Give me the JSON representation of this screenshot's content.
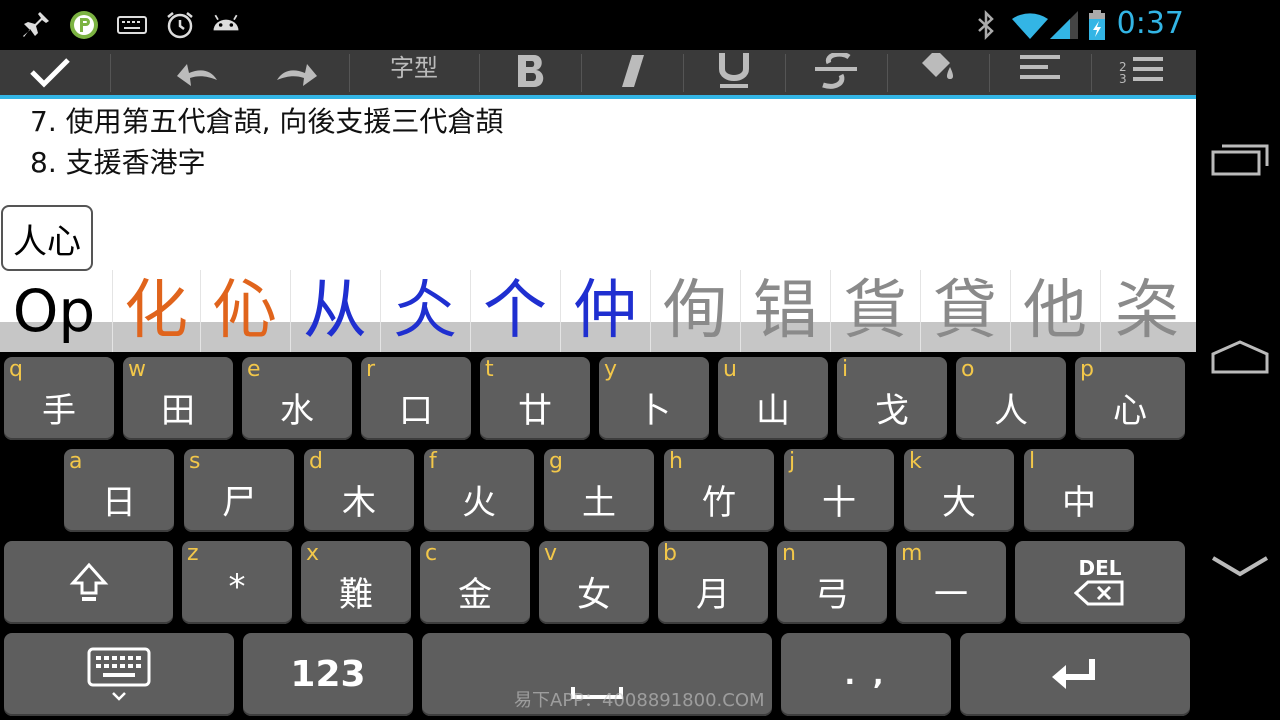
{
  "status_bar": {
    "time": "0:37",
    "left_icons": [
      "pin-icon",
      "app-p-icon",
      "keyboard-notification-icon",
      "alarm-icon",
      "android-icon"
    ],
    "right_icons": [
      "bluetooth-icon",
      "wifi-icon",
      "signal-icon",
      "battery-charging-icon"
    ],
    "accent_color": "#33b5e5"
  },
  "toolbar": {
    "font_label": "字型",
    "buttons": [
      "check-icon",
      "undo-icon",
      "redo-icon",
      "font-icon",
      "bold-icon",
      "italic-icon",
      "underline-icon",
      "strikethrough-icon",
      "fill-color-icon",
      "align-icon",
      "numbered-list-icon"
    ]
  },
  "document": {
    "lines": [
      "7. 使用第五代倉頡, 向後支援三代倉頡",
      "8. 支援香港字"
    ],
    "composing": "人心"
  },
  "candidates": {
    "items": [
      {
        "text": "Op",
        "color": "#000000"
      },
      {
        "text": "化",
        "color": "#e0641c"
      },
      {
        "text": "伈",
        "color": "#e0641c"
      },
      {
        "text": "从",
        "color": "#1f2fd0"
      },
      {
        "text": "仌",
        "color": "#1f2fd0"
      },
      {
        "text": "个",
        "color": "#1f2fd0"
      },
      {
        "text": "仲",
        "color": "#1f2fd0"
      },
      {
        "text": "侚",
        "color": "#8a8a8a"
      },
      {
        "text": "锠",
        "color": "#8a8a8a"
      },
      {
        "text": "貨",
        "color": "#8a8a8a"
      },
      {
        "text": "貸",
        "color": "#8a8a8a"
      },
      {
        "text": "他",
        "color": "#8a8a8a"
      },
      {
        "text": "栥",
        "color": "#8a8a8a"
      }
    ]
  },
  "keyboard": {
    "row1": [
      {
        "hint": "q",
        "label": "手"
      },
      {
        "hint": "w",
        "label": "田"
      },
      {
        "hint": "e",
        "label": "水"
      },
      {
        "hint": "r",
        "label": "口"
      },
      {
        "hint": "t",
        "label": "廿"
      },
      {
        "hint": "y",
        "label": "卜"
      },
      {
        "hint": "u",
        "label": "山"
      },
      {
        "hint": "i",
        "label": "戈"
      },
      {
        "hint": "o",
        "label": "人"
      },
      {
        "hint": "p",
        "label": "心"
      }
    ],
    "row2": [
      {
        "hint": "a",
        "label": "日"
      },
      {
        "hint": "s",
        "label": "尸"
      },
      {
        "hint": "d",
        "label": "木"
      },
      {
        "hint": "f",
        "label": "火"
      },
      {
        "hint": "g",
        "label": "土"
      },
      {
        "hint": "h",
        "label": "竹"
      },
      {
        "hint": "j",
        "label": "十"
      },
      {
        "hint": "k",
        "label": "大"
      },
      {
        "hint": "l",
        "label": "中"
      }
    ],
    "row3": [
      {
        "hint": "z",
        "label": "*"
      },
      {
        "hint": "x",
        "label": "難"
      },
      {
        "hint": "c",
        "label": "金"
      },
      {
        "hint": "v",
        "label": "女"
      },
      {
        "hint": "b",
        "label": "月"
      },
      {
        "hint": "n",
        "label": "弓"
      },
      {
        "hint": "m",
        "label": "一"
      }
    ],
    "del_label": "DEL",
    "numbers_label": "123",
    "punct_label": ". ,",
    "key_color": "#5e5e5e",
    "hint_color": "#f2c74a"
  },
  "watermark": "易下APP：4008891800.COM",
  "nav_bar": {
    "icons": [
      "recent-apps-icon",
      "home-icon",
      "back-hide-keyboard-icon"
    ]
  }
}
